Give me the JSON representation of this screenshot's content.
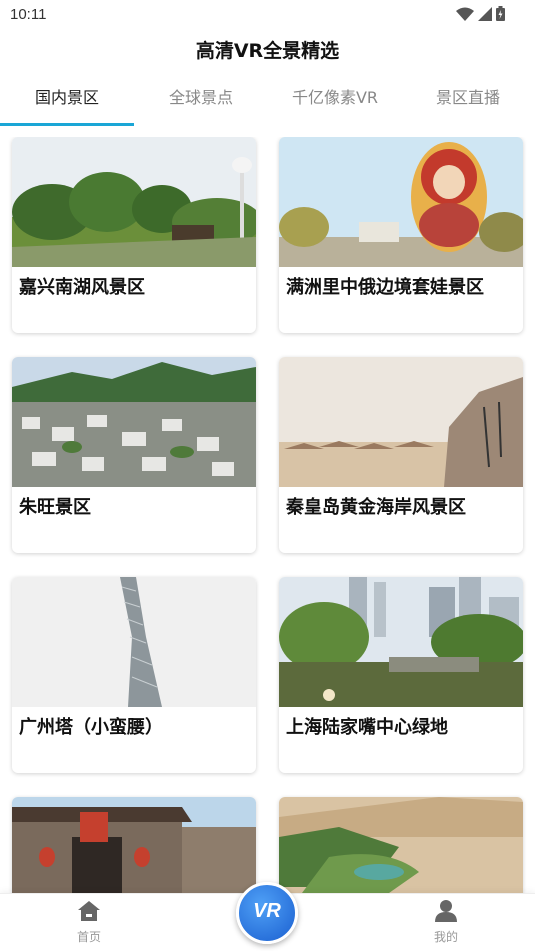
{
  "status_bar": {
    "time": "10:11"
  },
  "app_title": "高清VR全景精选",
  "tabs": [
    {
      "label": "国内景区",
      "active": true
    },
    {
      "label": "全球景点",
      "active": false
    },
    {
      "label": "千亿像素VR",
      "active": false
    },
    {
      "label": "景区直播",
      "active": false
    }
  ],
  "cards": [
    {
      "title": "嘉兴南湖风景区"
    },
    {
      "title": "满洲里中俄边境套娃景区"
    },
    {
      "title": "朱旺景区"
    },
    {
      "title": "秦皇岛黄金海岸风景区"
    },
    {
      "title": "广州塔（小蛮腰）"
    },
    {
      "title": "上海陆家嘴中心绿地"
    },
    {
      "title": ""
    },
    {
      "title": ""
    }
  ],
  "bottom_nav": {
    "home_label": "首页",
    "vr_label": "VR",
    "mine_label": "我的"
  },
  "colors": {
    "accent": "#1aa6d6",
    "vr_button": "#1a5fd0"
  },
  "icons": [
    "wifi-icon",
    "signal-icon",
    "battery-icon",
    "home-icon",
    "person-icon"
  ]
}
